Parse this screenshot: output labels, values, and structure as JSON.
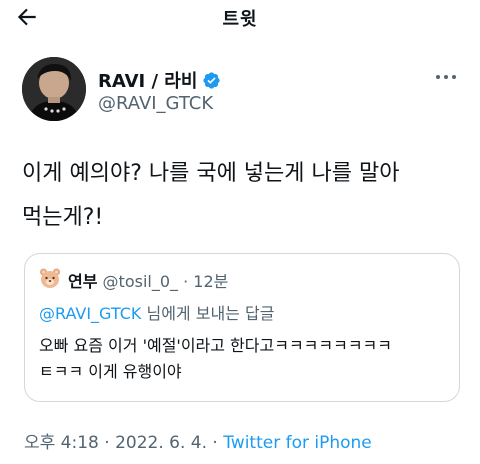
{
  "header": {
    "title": "트윗"
  },
  "tweet": {
    "display_name": "RAVI / 라비",
    "handle": "@RAVI_GTCK",
    "text_line1": "이게 예의야? 나를 국에 넣는게 나를 말아",
    "text_line2": "먹는게?!",
    "time": "오후 4:18",
    "separator": " · ",
    "date": "2022. 6. 4.",
    "source": "Twitter for iPhone"
  },
  "quote": {
    "name": "연부",
    "handle": "@tosil_0_",
    "separator": " · ",
    "time_ago": "12분",
    "reply_mention": "@RAVI_GTCK",
    "reply_suffix": " 님에게 보내는 답글",
    "text_line1": "오빠 요즘 이거 '예절'이라고 한다고ㅋㅋㅋㅋㅋㅋㅋㅋ",
    "text_line2": "ㅌㅋㅋ 이게 유행이야"
  },
  "icons": {
    "back": "arrow-left-icon",
    "verified": "verified-badge-icon",
    "more": "more-horizontal-icon",
    "quote_avatar": "bear-emoji-avatar"
  },
  "colors": {
    "accent": "#1d9bf0",
    "secondary_text": "#536471",
    "border": "#cfd9de"
  }
}
